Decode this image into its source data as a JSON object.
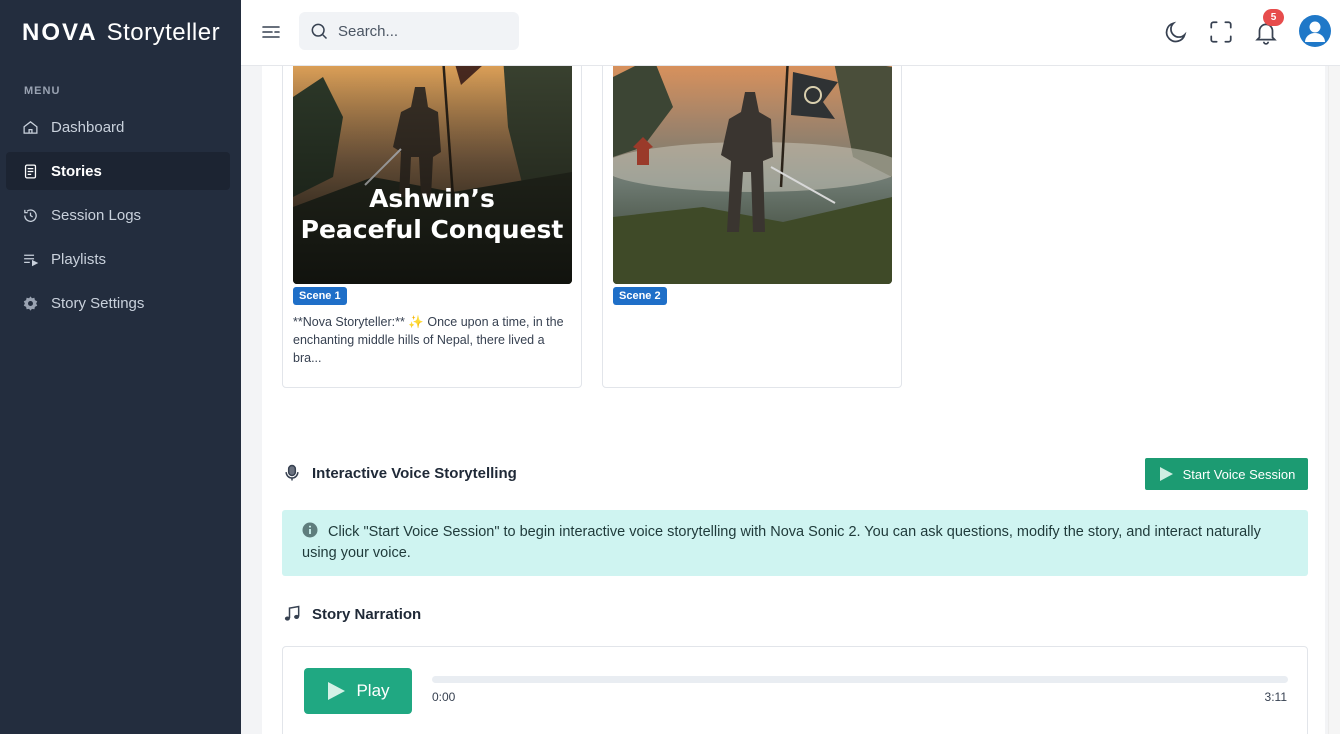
{
  "brand": {
    "part1": "NOVA",
    "part2": "Storyteller"
  },
  "sidebar": {
    "menu_label": "MENU",
    "items": [
      {
        "label": "Dashboard",
        "icon": "home-icon",
        "active": false
      },
      {
        "label": "Stories",
        "icon": "document-icon",
        "active": true
      },
      {
        "label": "Session Logs",
        "icon": "history-icon",
        "active": false
      },
      {
        "label": "Playlists",
        "icon": "playlist-icon",
        "active": false
      },
      {
        "label": "Story Settings",
        "icon": "gear-icon",
        "active": false
      }
    ]
  },
  "header": {
    "search_placeholder": "Search...",
    "notification_count": "5"
  },
  "scenes": [
    {
      "badge": "Scene 1",
      "overlay_line1": "Ashwin’s",
      "overlay_line2": "Peaceful Conquest",
      "text": "**Nova Storyteller:** ✨ Once upon a time, in the enchanting middle hills of Nepal, there lived a bra..."
    },
    {
      "badge": "Scene 2",
      "overlay_line1": "",
      "overlay_line2": "",
      "text": ""
    }
  ],
  "voice": {
    "title": "Interactive Voice Storytelling",
    "button_label": "Start Voice Session",
    "info_text": "Click \"Start Voice Session\" to begin interactive voice storytelling with Nova Sonic 2. You can ask questions, modify the story, and interact naturally using your voice."
  },
  "narration": {
    "title": "Story Narration",
    "play_label": "Play",
    "current_time": "0:00",
    "duration": "3:11",
    "progress": 0
  },
  "colors": {
    "sidebar_bg": "#232d3e",
    "accent_green": "#1c9b72",
    "badge_blue": "#1f6fc8",
    "info_bg": "#cff4f1",
    "notification_red": "#e74c4c"
  }
}
